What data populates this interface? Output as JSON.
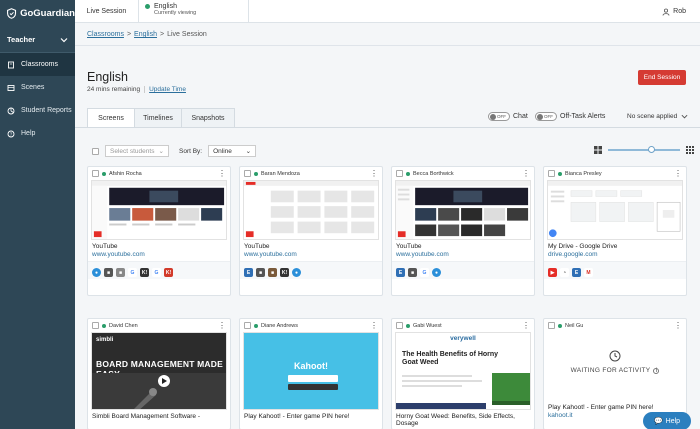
{
  "app": {
    "logo": "GoGuardian"
  },
  "sidebar": {
    "role": "Teacher",
    "items": [
      {
        "label": "Classrooms",
        "icon": "classroom-icon"
      },
      {
        "label": "Scenes",
        "icon": "scenes-icon"
      },
      {
        "label": "Student Reports",
        "icon": "reports-icon"
      },
      {
        "label": "Help",
        "icon": "help-icon"
      }
    ]
  },
  "topbar": {
    "live": "Live Session",
    "class_name": "English",
    "class_status": "Currently viewing",
    "user": "Rob"
  },
  "breadcrumb": [
    "Classrooms",
    "English",
    "Live Session"
  ],
  "session": {
    "title": "English",
    "remaining": "24 mins remaining",
    "update": "Update Time",
    "end": "End Session"
  },
  "tabs": [
    "Screens",
    "Timelines",
    "Snapshots"
  ],
  "toggles": {
    "chat": {
      "state": "OFF",
      "label": "Chat"
    },
    "offtask": {
      "state": "OFF",
      "label": "Off-Task Alerts"
    }
  },
  "scene": "No scene applied",
  "controls": {
    "select_placeholder": "Select students",
    "sort_label": "Sort By:",
    "sort_value": "Online"
  },
  "students": [
    {
      "name": "Afshin Rocha",
      "title": "YouTube",
      "url": "www.youtube.com"
    },
    {
      "name": "Baran Mendoza",
      "title": "YouTube",
      "url": "www.youtube.com"
    },
    {
      "name": "Becca Borthwick",
      "title": "YouTube",
      "url": "www.youtube.com"
    },
    {
      "name": "Bianca Presley",
      "title": "My Drive - Google Drive",
      "url": "drive.google.com"
    },
    {
      "name": "David Chen",
      "title": "Simbli Board Management Software -",
      "url": "",
      "shot_text": "BOARD MANAGEMENT MADE EASY",
      "shot_logo": "simbli"
    },
    {
      "name": "Diane Andrews",
      "title": "Play Kahoot! - Enter game PIN here!",
      "url": "",
      "shot_text": "Kahoot!"
    },
    {
      "name": "Gabi Wuest",
      "title": "Horny Goat Weed: Benefits, Side Effects, Dosage",
      "url": "",
      "shot_logo": "verywell",
      "shot_text": "The Health Benefits of Horny Goat Weed"
    },
    {
      "name": "Neil Gu",
      "title": "Play Kahoot! - Enter game PIN here!",
      "url": "kahoot.it",
      "waiting": "WAITING FOR ACTIVITY"
    }
  ],
  "help": "Help"
}
